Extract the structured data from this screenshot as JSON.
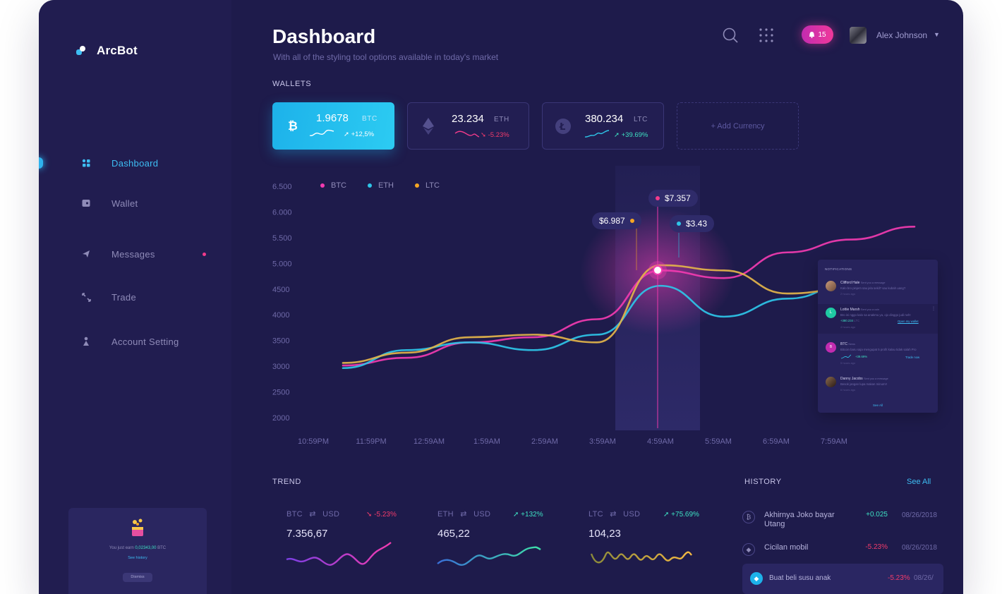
{
  "app": {
    "name": "ArcBot"
  },
  "header": {
    "title": "Dashboard",
    "subtitle": "With all of the styling tool options available in today's market",
    "notifications": "15",
    "user_name": "Alex Johnson"
  },
  "sidebar": {
    "items": [
      {
        "label": "Dashboard",
        "icon": "dashboard-icon",
        "active": true
      },
      {
        "label": "Wallet",
        "icon": "wallet-icon"
      },
      {
        "label": "Messages",
        "icon": "paper-plane-icon",
        "badge": true
      },
      {
        "label": "Trade",
        "icon": "arrows-icon"
      },
      {
        "label": "Account Setting",
        "icon": "user-icon"
      }
    ],
    "promo": {
      "earn_prefix": "You just earn",
      "earn_amount": "0,02343,00",
      "earn_unit": "BTC",
      "history_link": "See history",
      "dismiss": "Dismiss"
    }
  },
  "wallets": {
    "section_label": "WALLETS",
    "cards": [
      {
        "amount": "1.9678",
        "currency": "BTC",
        "change": "+12,5%",
        "icon": "bitcoin-icon"
      },
      {
        "amount": "23.234",
        "currency": "ETH",
        "change": "-5.23%",
        "icon": "ethereum-icon"
      },
      {
        "amount": "380.234",
        "currency": "LTC",
        "change": "+39.69%",
        "icon": "litecoin-icon"
      }
    ],
    "add_label": "+ Add Currency"
  },
  "chart_data": {
    "type": "line",
    "legend": [
      "BTC",
      "ETH",
      "LTC"
    ],
    "legend_position": "top-left",
    "y_ticks": [
      "6.500",
      "6.000",
      "5.500",
      "5.000",
      "4500",
      "4000",
      "3500",
      "3000",
      "2500",
      "2000"
    ],
    "x": [
      "10:59PM",
      "11:59PM",
      "12:59AM",
      "1:59AM",
      "2:59AM",
      "3:59AM",
      "4:59AM",
      "5:59AM",
      "6:59AM",
      "7:59AM"
    ],
    "ylim": [
      2000,
      6500
    ],
    "series": [
      {
        "name": "BTC",
        "color": "#f23bb0",
        "values": [
          3000,
          3150,
          3450,
          3550,
          3900,
          4850,
          4700,
          5200,
          5450,
          5700
        ]
      },
      {
        "name": "ETH",
        "color": "#2ec5e8",
        "values": [
          2950,
          3300,
          3450,
          3300,
          3600,
          4550,
          3950,
          4300,
          4600,
          4900
        ]
      },
      {
        "name": "LTC",
        "color": "#e3b44a",
        "values": [
          3050,
          3250,
          3550,
          3600,
          3450,
          4950,
          4850,
          4400,
          4500,
          4750
        ]
      }
    ],
    "tooltips": [
      {
        "label": "$6.987",
        "color": "#f5a623"
      },
      {
        "label": "$7.357",
        "color": "#f23b8b"
      },
      {
        "label": "$3.43",
        "color": "#2ec5e8"
      }
    ]
  },
  "notifications_panel": {
    "title": "NOTIFICATIONS",
    "items": [
      {
        "name": "Clifford Hale",
        "action": "Sent you a message",
        "message": "Kalo bro pinjem sau jela sekil? sau kubah uang?",
        "time": "2 hours ago"
      },
      {
        "name": "Lottie Marsh",
        "action": "Sent you a coin",
        "message": "Bro ini nggo kalo sa anakmu ya, ojo dinggo judi neh!",
        "amount": "+380.234",
        "unit": "LTC",
        "link": "Open my wallet",
        "time": "4 hours ago"
      },
      {
        "name": "BTC",
        "action": "News",
        "message": "Bitcoin baru saja mengupat 5 profit kalau tidak salah Pro",
        "amount": "+39.69%",
        "link": "Trade now",
        "time": "5 hours ago"
      },
      {
        "name": "Danny Jacobs",
        "action": "Sent you a message",
        "message": "Besok jangan lupa makan minum!!",
        "time": "6 hours ago"
      }
    ],
    "see_all": "See All"
  },
  "trend": {
    "section_label": "TREND",
    "cards": [
      {
        "from": "BTC",
        "to": "USD",
        "change": "-5.23%",
        "value": "7.356,67"
      },
      {
        "from": "ETH",
        "to": "USD",
        "change": "+132%",
        "value": "465,22"
      },
      {
        "from": "LTC",
        "to": "USD",
        "change": "+75.69%",
        "value": "104,23"
      }
    ]
  },
  "history": {
    "section_label": "HISTORY",
    "see_all": "See All",
    "items": [
      {
        "label": "Akhirnya Joko bayar Utang",
        "amount": "+0.025",
        "date": "08/26/2018",
        "icon": "bitcoin-icon"
      },
      {
        "label": "Cicilan mobil",
        "amount": "-5.23%",
        "date": "08/26/2018",
        "icon": "ethereum-icon"
      },
      {
        "label": "Buat beli susu anak",
        "amount": "-5.23%",
        "date": "08/26/",
        "icon": "ethereum-icon"
      }
    ]
  },
  "colors": {
    "background": "#1e1b4b",
    "accent": "#2fb3ee",
    "positive": "#3ee0c2",
    "negative": "#f23b6b",
    "btc": "#f23bb0",
    "eth": "#2ec5e8",
    "ltc": "#e3b44a"
  }
}
